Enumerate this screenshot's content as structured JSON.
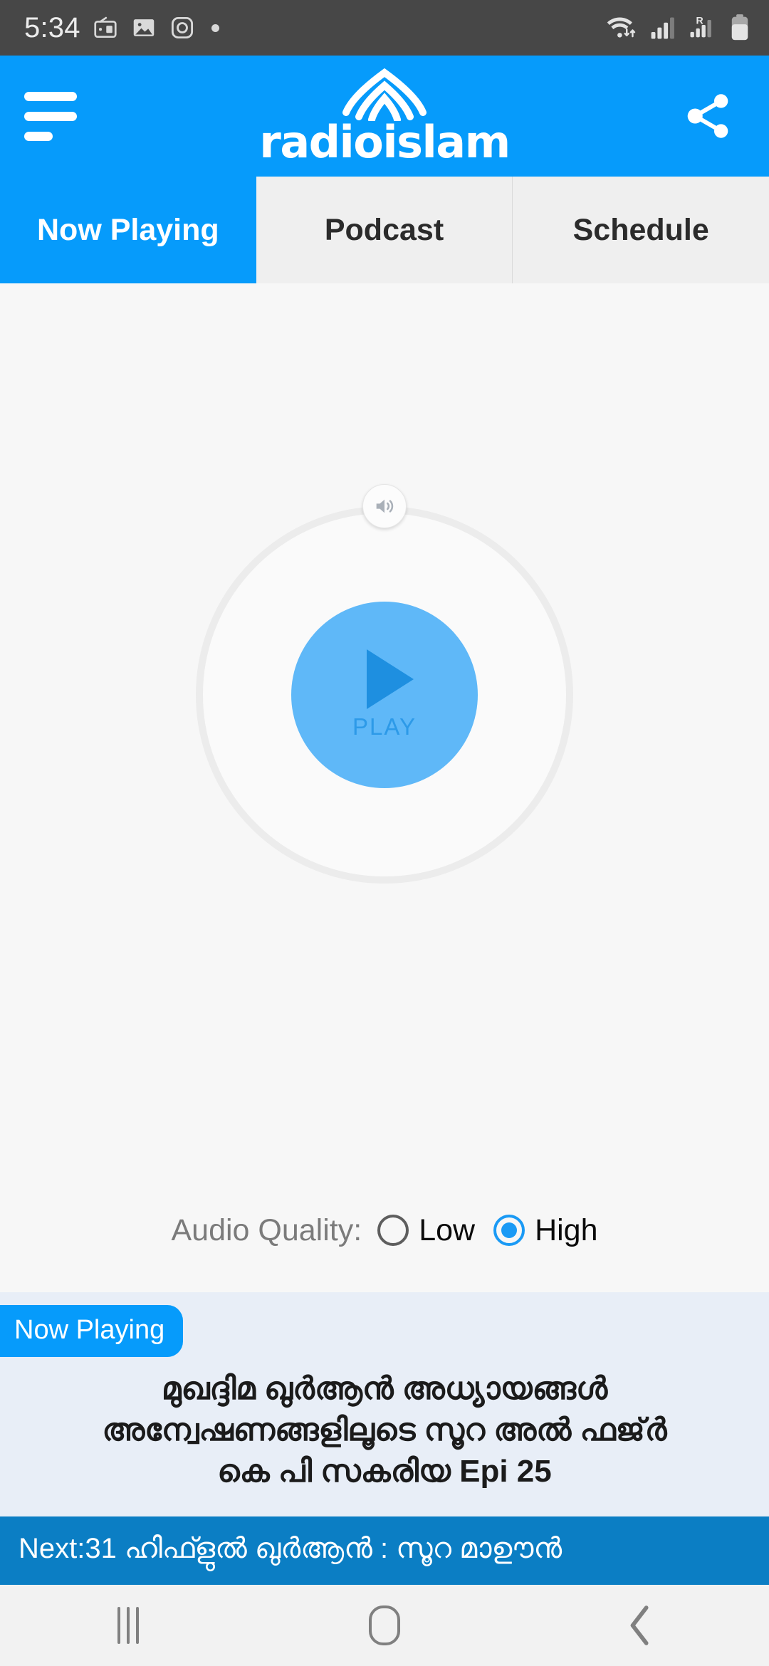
{
  "status_bar": {
    "time": "5:34",
    "left_icons": [
      "radio-icon",
      "image-icon",
      "instagram-icon",
      "dot-indicator"
    ],
    "right_icons": [
      "wifi-data-icon",
      "signal-bars-icon",
      "signal-roaming-icon",
      "battery-icon"
    ],
    "roaming_label": "R",
    "background": "#474747"
  },
  "header": {
    "menu_icon": "hamburger-menu-icon",
    "logo_mark": "radioislam-arch-logo-icon",
    "brand_name": "radioislam",
    "share_icon": "share-icon",
    "background": "#069bfb"
  },
  "tabs": {
    "items": [
      {
        "label": "Now Playing",
        "active": true
      },
      {
        "label": "Podcast",
        "active": false
      },
      {
        "label": "Schedule",
        "active": false
      }
    ],
    "active_bg": "#069bfb",
    "inactive_bg": "#efefef"
  },
  "player": {
    "volume_knob_icon": "volume-speaker-icon",
    "play_label": "PLAY",
    "play_icon": "play-triangle-icon",
    "button_color": "#5fb8f8",
    "triangle_color": "#1e8fe0",
    "ring_color": "#ececec"
  },
  "audio_quality": {
    "label": "Audio Quality:",
    "options": [
      {
        "label": "Low",
        "selected": false
      },
      {
        "label": "High",
        "selected": true
      }
    ],
    "selected_color": "#1a9af5"
  },
  "now_playing": {
    "badge": "Now Playing",
    "title_line1": "മുഖദ്ദിമ  ഖുർആൻ അധ്യായങ്ങൾ",
    "title_line2": "അന്വേഷണങ്ങളിലൂടെ സൂറ അൽ ഫജ്ർ",
    "title_line3": "കെ പി സകരിയ Epi 25",
    "background": "#e8eef7"
  },
  "next_up": {
    "text": "Next:31  ഹിഫ്ളുൽ ഖുർആൻ : സൂറ മാഊൻ",
    "background": "#0b7ec4"
  },
  "nav_bar": {
    "recents_icon": "recents-icon",
    "home_icon": "home-icon",
    "back_icon": "back-chevron-icon"
  }
}
